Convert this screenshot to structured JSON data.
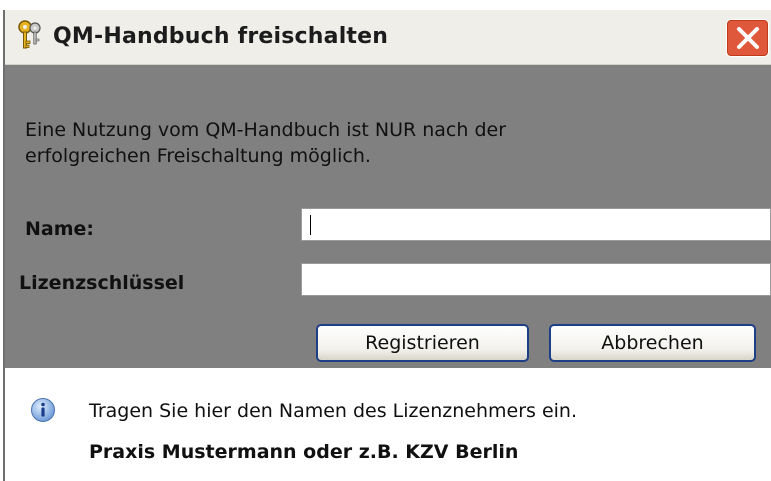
{
  "window": {
    "title": "QM-Handbuch freischalten"
  },
  "form": {
    "description_line1": "Eine Nutzung vom QM-Handbuch ist NUR nach der",
    "description_line2": "erfolgreichen Freischaltung möglich.",
    "name_label": "Name:",
    "name_value": "",
    "license_label": "Lizenzschlüssel",
    "license_value": ""
  },
  "buttons": {
    "register": "Registrieren",
    "cancel": "Abbrechen"
  },
  "hint": {
    "line1": "Tragen Sie hier den Namen des Lizenznehmers ein.",
    "line2": "Praxis Mustermann oder z.B. KZV Berlin"
  },
  "icons": {
    "title": "keys-icon",
    "close": "close-icon",
    "info": "info-icon"
  },
  "colors": {
    "panel": "#808080",
    "close_button": "#e0583b",
    "button_border": "#1d3f86",
    "titlebar": "#efeee9"
  }
}
